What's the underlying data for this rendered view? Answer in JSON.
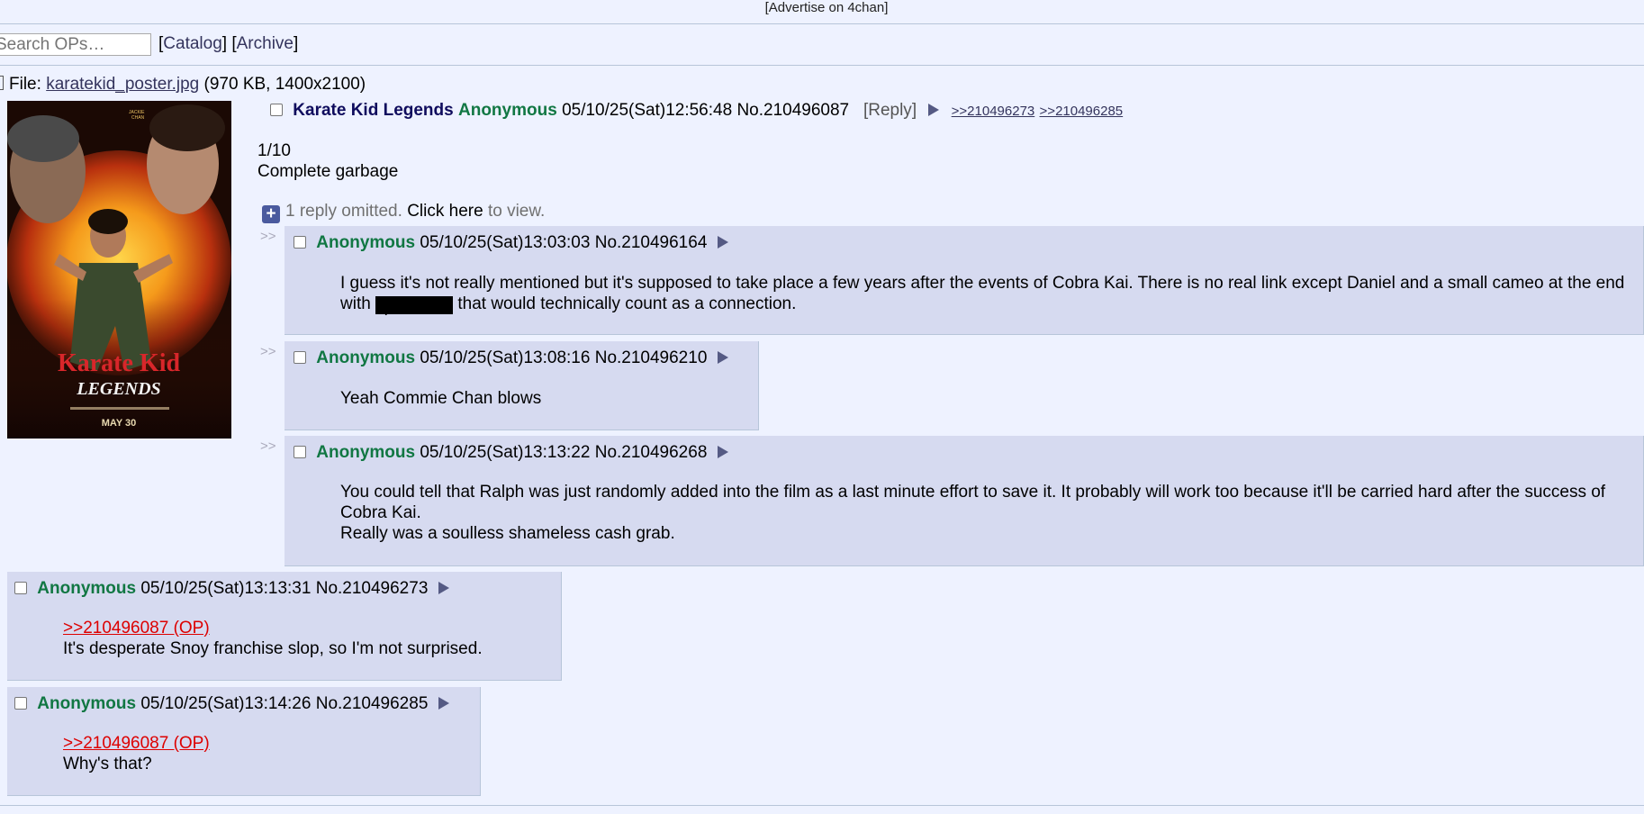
{
  "header": {
    "advertise": "[Advertise on 4chan]",
    "search_placeholder": "Search OPs…",
    "catalog": "Catalog",
    "archive": "Archive"
  },
  "op": {
    "file_label": "File:",
    "file_name": "karatekid_poster.jpg",
    "file_meta": "(970 KB, 1400x2100)",
    "subject": "Karate Kid Legends",
    "name": "Anonymous",
    "datetime": "05/10/25(Sat)12:56:48",
    "number": "No.210496087",
    "reply_label": "Reply",
    "backlinks": [
      ">>210496273",
      ">>210496285"
    ],
    "lines": [
      "1/10",
      "Complete garbage"
    ],
    "poster": {
      "title_line1": "Karate Kid",
      "title_line2": "LEGENDS",
      "date": "MAY 30"
    }
  },
  "omitted": {
    "prefix": "1 reply omitted.",
    "link": "Click here",
    "suffix": "to view."
  },
  "side_marker": ">>",
  "replies": [
    {
      "name": "Anonymous",
      "datetime": "05/10/25(Sat)13:03:03",
      "number": "No.210496164",
      "text_before": "I guess it's not really mentioned but it's supposed to take place a few years after the events of Cobra Kai. There is no real link except Daniel and a small cameo at the end with",
      "spoiler": "spoiler",
      "text_after": "that would technically count as a connection."
    },
    {
      "name": "Anonymous",
      "datetime": "05/10/25(Sat)13:08:16",
      "number": "No.210496210",
      "text": "Yeah Commie Chan blows"
    },
    {
      "name": "Anonymous",
      "datetime": "05/10/25(Sat)13:13:22",
      "number": "No.210496268",
      "line1": "You could tell that Ralph was just randomly added into the film as a last minute effort to save it. It probably will work too because it'll be carried hard after the success of Cobra Kai.",
      "line2": "Really was a soulless shameless cash grab."
    },
    {
      "name": "Anonymous",
      "datetime": "05/10/25(Sat)13:13:31",
      "number": "No.210496273",
      "quote": ">>210496087 (OP)",
      "text": "It's desperate Snoy franchise slop, so I'm not surprised."
    },
    {
      "name": "Anonymous",
      "datetime": "05/10/25(Sat)13:14:26",
      "number": "No.210496285",
      "quote": ">>210496087 (OP)",
      "text": "Why's that?"
    }
  ]
}
